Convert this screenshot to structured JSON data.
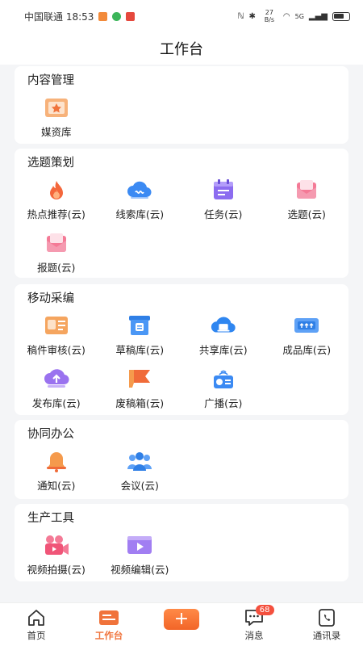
{
  "status": {
    "carrier_time": "中国联通 18:53",
    "net_speed": "27 B/s",
    "signal": "5G"
  },
  "header": {
    "title": "工作台"
  },
  "sections": [
    {
      "title": "内容管理",
      "items": [
        {
          "label": "媒资库",
          "icon": "media-library-icon"
        }
      ]
    },
    {
      "title": "选题策划",
      "items": [
        {
          "label": "热点推荐(云)",
          "icon": "fire-icon"
        },
        {
          "label": "线索库(云)",
          "icon": "cloud-clue-icon"
        },
        {
          "label": "任务(云)",
          "icon": "task-calendar-icon"
        },
        {
          "label": "选题(云)",
          "icon": "topic-envelope-icon"
        },
        {
          "label": "报题(云)",
          "icon": "report-envelope-icon"
        }
      ]
    },
    {
      "title": "移动采编",
      "items": [
        {
          "label": "稿件审核(云)",
          "icon": "manuscript-review-icon"
        },
        {
          "label": "草稿库(云)",
          "icon": "draft-library-icon"
        },
        {
          "label": "共享库(云)",
          "icon": "shared-cloud-icon"
        },
        {
          "label": "成品库(云)",
          "icon": "finished-library-icon"
        },
        {
          "label": "发布库(云)",
          "icon": "publish-upload-icon"
        },
        {
          "label": "废稿箱(云)",
          "icon": "trash-flag-icon"
        },
        {
          "label": "广播(云)",
          "icon": "broadcast-radio-icon"
        }
      ]
    },
    {
      "title": "协同办公",
      "items": [
        {
          "label": "通知(云)",
          "icon": "notification-bell-icon"
        },
        {
          "label": "会议(云)",
          "icon": "meeting-people-icon"
        }
      ]
    },
    {
      "title": "生产工具",
      "items": [
        {
          "label": "视频拍摄(云)",
          "icon": "video-camera-icon"
        },
        {
          "label": "视频编辑(云)",
          "icon": "video-edit-icon"
        }
      ]
    }
  ],
  "nav": {
    "home": "首页",
    "workbench": "工作台",
    "add": "+",
    "messages": "消息",
    "messages_badge": "68",
    "contacts": "通讯录"
  },
  "colors": {
    "accent": "#f0733b",
    "badge": "#f4503e"
  }
}
